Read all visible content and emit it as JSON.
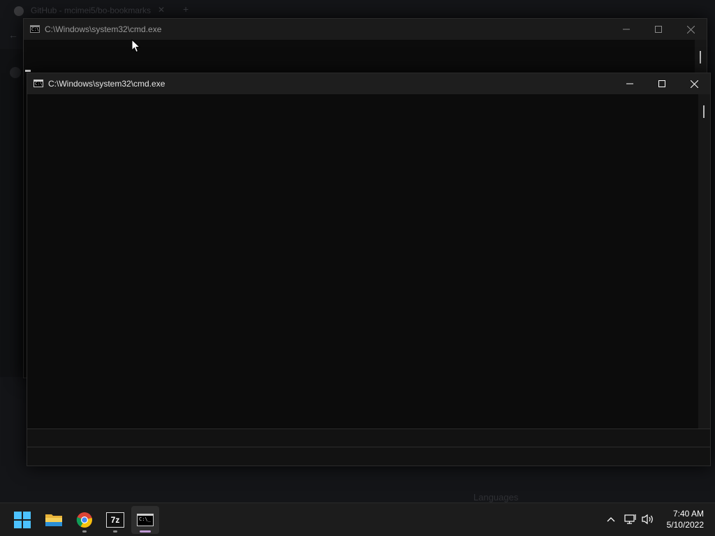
{
  "background_browser": {
    "tab_title": "GitHub - mcimei5/bo-bookmarks",
    "close_glyph": "✕",
    "new_tab_glyph": "+",
    "back_glyph": "←",
    "partial_text": "Languages"
  },
  "cmd_back": {
    "title": "C:\\Windows\\system32\\cmd.exe",
    "icon": "cmd-icon",
    "icon_text": "C:\\"
  },
  "cmd_front": {
    "title": "C:\\Windows\\system32\\cmd.exe",
    "icon": "cmd-icon",
    "icon_text": "C:\\"
  },
  "taskbar": {
    "apps": [
      {
        "name": "start",
        "icon": "windows-logo-icon"
      },
      {
        "name": "file-explorer",
        "icon": "folder-icon"
      },
      {
        "name": "chrome",
        "icon": "chrome-icon"
      },
      {
        "name": "7zip",
        "icon": "7zip-icon",
        "label": "7z"
      },
      {
        "name": "terminal",
        "icon": "terminal-icon",
        "label": "C:\\_"
      }
    ],
    "tray": {
      "chevron": "^",
      "network": "network-icon",
      "volume": "volume-icon"
    },
    "clock": {
      "time": "7:40 AM",
      "date": "5/10/2022"
    }
  },
  "colors": {
    "terminal_bg": "#0c0c0c",
    "titlebar_bg": "#1e1e1e",
    "taskbar_bg": "#1c1c1c",
    "accent_indicator": "#c19bd6"
  }
}
